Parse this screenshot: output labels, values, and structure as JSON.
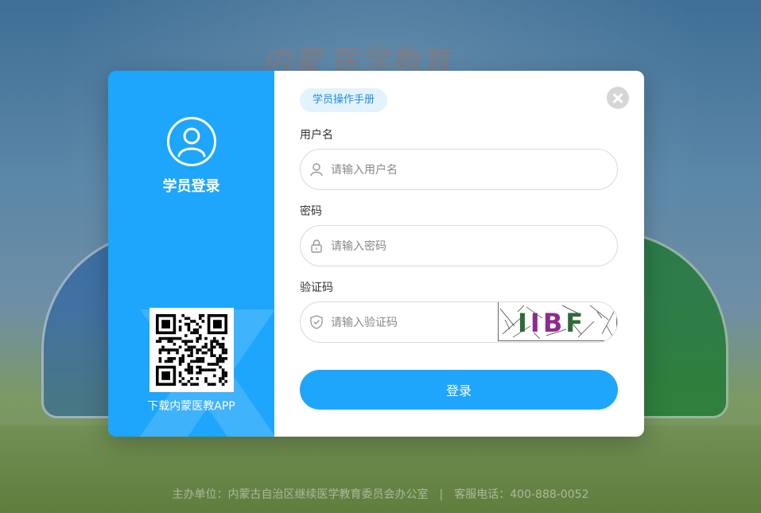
{
  "background": {
    "logo_mark": "内蒙",
    "logo_text": "医学教育"
  },
  "panel": {
    "title": "学员登录",
    "app_download_label": "下载内蒙医教APP",
    "accent_color": "#1da6fc"
  },
  "form": {
    "manual_link": "学员操作手册",
    "username": {
      "label": "用户名",
      "placeholder": "请输入用户名",
      "icon": "user-icon"
    },
    "password": {
      "label": "密码",
      "placeholder": "请输入密码",
      "icon": "lock-icon"
    },
    "captcha": {
      "label": "验证码",
      "placeholder": "请输入验证码",
      "icon": "shield-icon",
      "chars": [
        "I",
        "I",
        "B",
        "F"
      ],
      "char_colors": [
        "#2f6b3a",
        "#8e2b8e",
        "#8e2b8e",
        "#2f6b3a"
      ]
    },
    "submit_label": "登录"
  },
  "footer": {
    "host": "主办单位：内蒙古自治区继续医学教育委员会办公室",
    "separator": "|",
    "hotline": "客服电话：400-888-0052"
  }
}
